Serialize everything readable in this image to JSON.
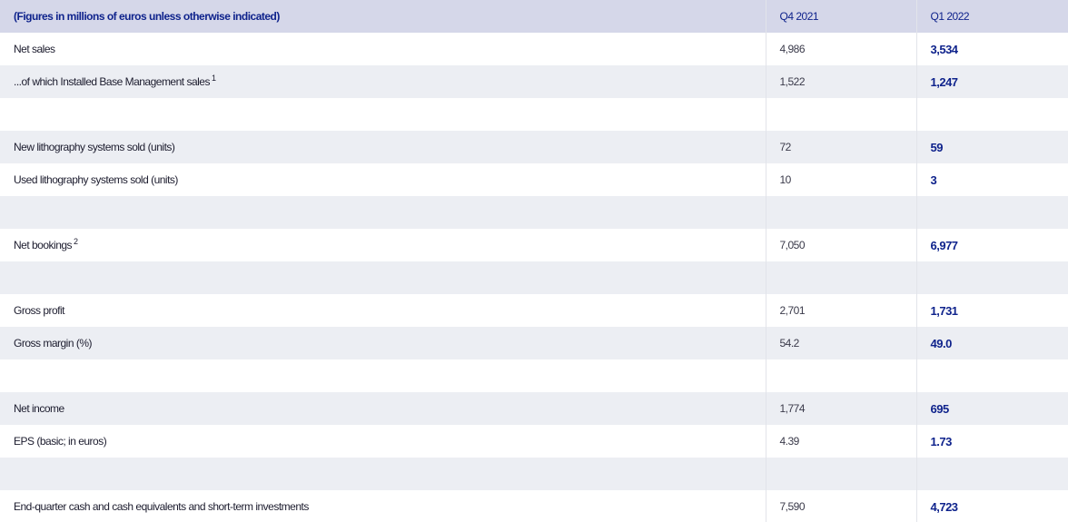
{
  "table": {
    "header": {
      "label": "(Figures in millions of euros unless otherwise indicated)",
      "q4": "Q4 2021",
      "q1": "Q1 2022"
    },
    "rows": [
      {
        "label": "Net sales",
        "sup": "",
        "q4": "4,986",
        "q1": "3,534"
      },
      {
        "label": "...of which Installed Base Management sales",
        "sup": "1",
        "q4": "1,522",
        "q1": "1,247"
      },
      {
        "label": "",
        "sup": "",
        "q4": "",
        "q1": ""
      },
      {
        "label": "New lithography systems sold (units)",
        "sup": "",
        "q4": "72",
        "q1": "59"
      },
      {
        "label": "Used lithography systems sold (units)",
        "sup": "",
        "q4": "10",
        "q1": "3"
      },
      {
        "label": "",
        "sup": "",
        "q4": "",
        "q1": ""
      },
      {
        "label": "Net bookings",
        "sup": "2",
        "q4": "7,050",
        "q1": "6,977"
      },
      {
        "label": "",
        "sup": "",
        "q4": "",
        "q1": ""
      },
      {
        "label": "Gross profit",
        "sup": "",
        "q4": "2,701",
        "q1": "1,731"
      },
      {
        "label": "Gross margin (%)",
        "sup": "",
        "q4": "54.2",
        "q1": "49.0"
      },
      {
        "label": "",
        "sup": "",
        "q4": "",
        "q1": ""
      },
      {
        "label": "Net income",
        "sup": "",
        "q4": "1,774",
        "q1": "695"
      },
      {
        "label": "EPS (basic; in euros)",
        "sup": "",
        "q4": "4.39",
        "q1": "1.73"
      },
      {
        "label": "",
        "sup": "",
        "q4": "",
        "q1": ""
      },
      {
        "label": "End-quarter cash and cash equivalents and short-term investments",
        "sup": "",
        "q4": "7,590",
        "q1": "4,723"
      }
    ]
  }
}
